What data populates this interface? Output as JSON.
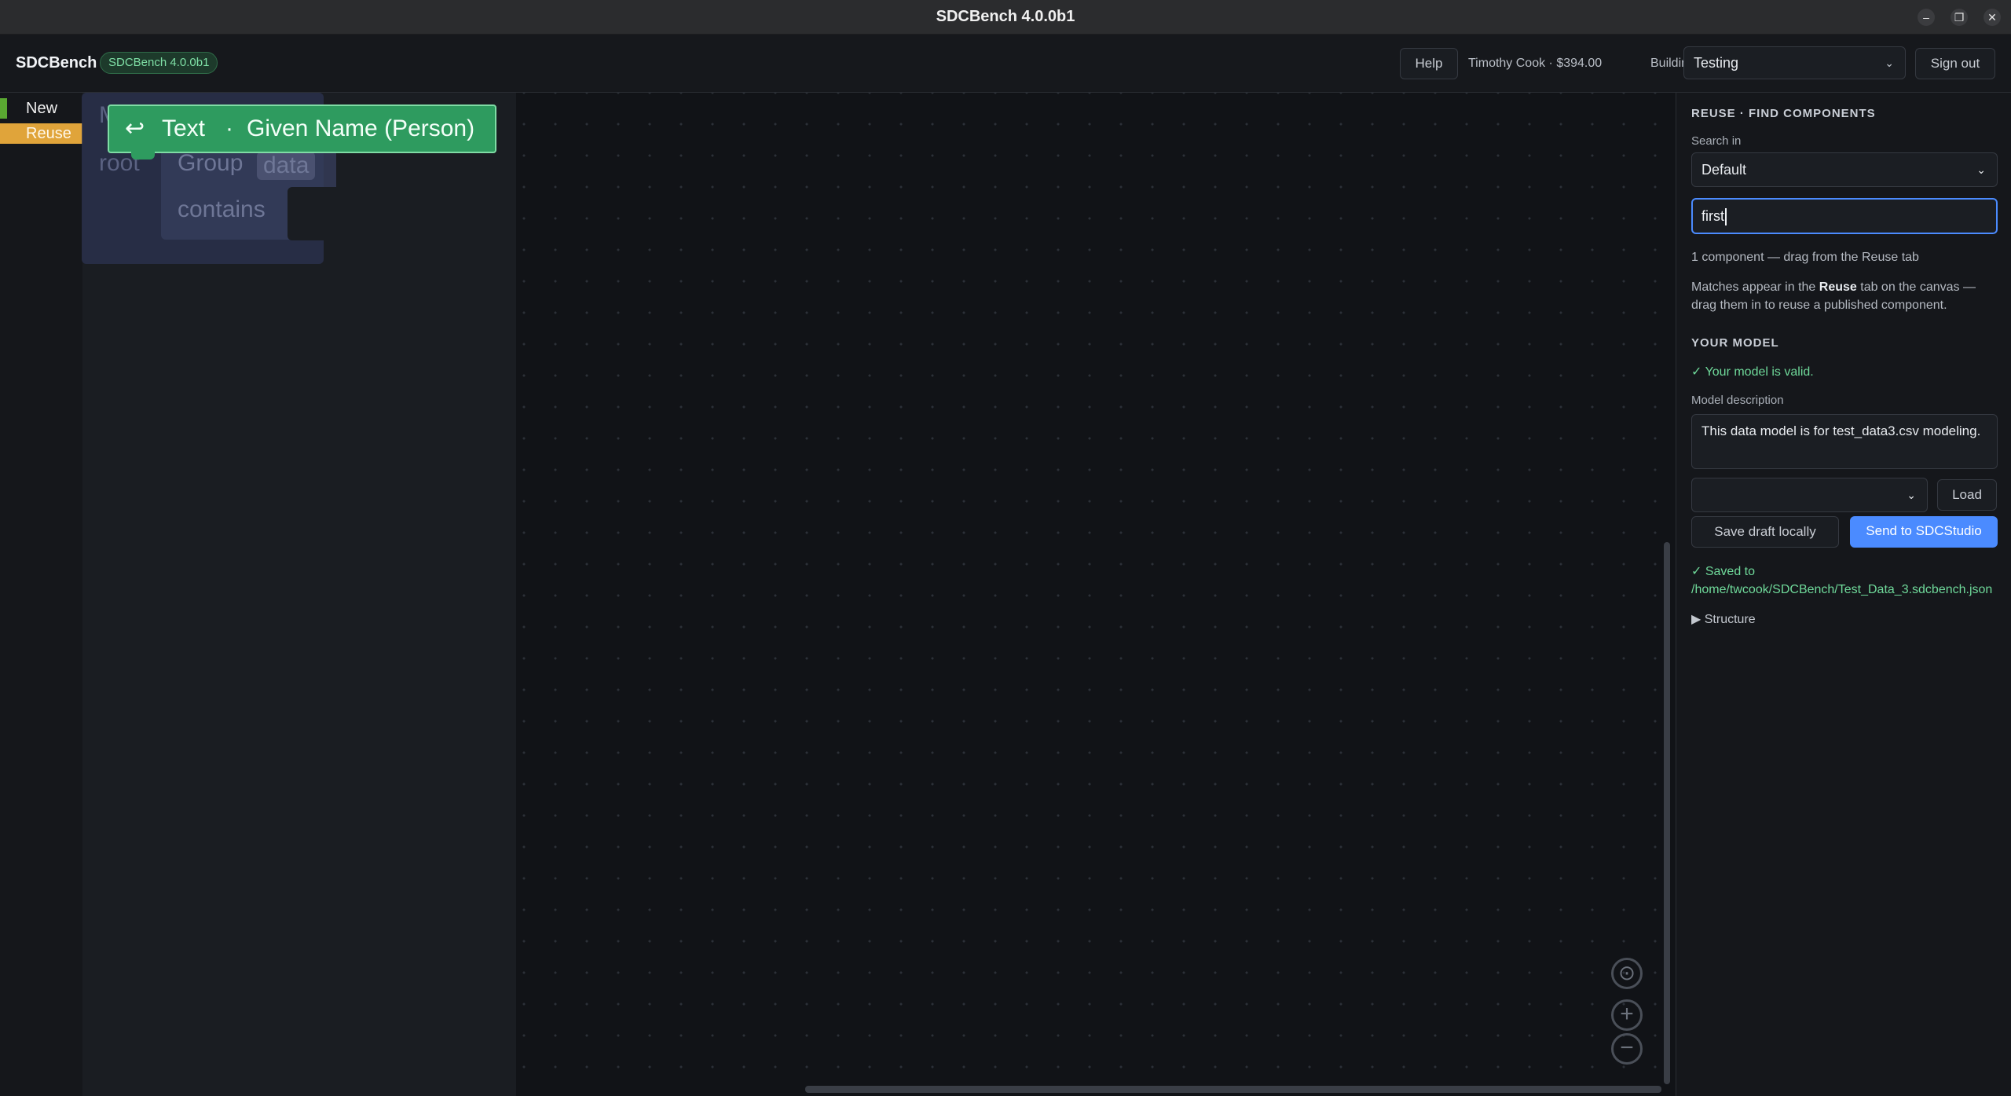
{
  "window": {
    "title": "SDCBench 4.0.0b1"
  },
  "header": {
    "brand": "SDCBench",
    "version_badge": "SDCBench 4.0.0b1",
    "help_label": "Help",
    "user_info": "Timothy Cook · $394.00",
    "building_in_label": "Building in",
    "project_select": "Testing",
    "sign_out_label": "Sign out"
  },
  "toolbox": {
    "categories": [
      {
        "label": "New",
        "color": "#5aa832"
      },
      {
        "label": "Reuse",
        "color": "#e0a43a"
      }
    ]
  },
  "flyout": {
    "ghost_prefix": "M",
    "ghost_root": "root",
    "ghost_group": "Group",
    "ghost_group_chip": "data",
    "ghost_contains": "contains"
  },
  "drag_block": {
    "arrow": "↩",
    "type": "Text",
    "separator": "·",
    "name": "Given Name (Person)"
  },
  "panel": {
    "reuse_heading": "REUSE · FIND COMPONENTS",
    "search_in_label": "Search in",
    "search_in_value": "Default",
    "search_value": "first",
    "result_count": "1 component — drag from the Reuse tab",
    "hint_prefix": "Matches appear in the ",
    "hint_bold": "Reuse",
    "hint_suffix": " tab on the canvas — drag them in to reuse a published component.",
    "model_heading": "YOUR MODEL",
    "valid_text": "✓ Your model is valid.",
    "desc_label": "Model description",
    "desc_value": "This data model is for test_data3.csv modeling.",
    "load_select_value": "",
    "load_label": "Load",
    "save_draft_label": "Save draft locally",
    "send_label": "Send to SDCStudio",
    "saved_line1": "✓ Saved to",
    "saved_line2": "/home/twcook/SDCBench/Test_Data_3.sdcbench.json",
    "structure_label": "▶ Structure"
  },
  "colors": {
    "accent": "#4b8bff",
    "valid": "#6fd99a",
    "drag_block": "#2e9b5f"
  }
}
